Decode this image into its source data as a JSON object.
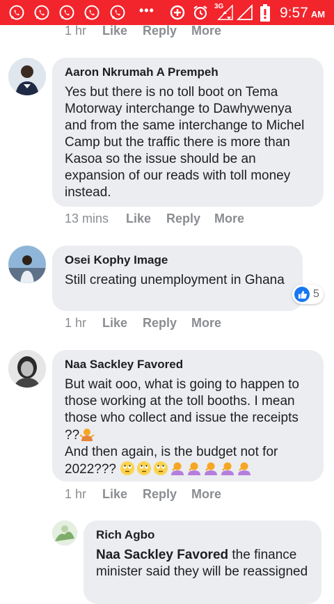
{
  "statusbar": {
    "network": "3G",
    "time": "9:57",
    "ampm": "AM",
    "color": "#f2242c"
  },
  "labels": {
    "like": "Like",
    "reply": "Reply",
    "more": "More"
  },
  "top_actions": {
    "time": "1 hr"
  },
  "comments": [
    {
      "author": "Aaron Nkrumah A Prempeh",
      "text": "Yes but there is no toll boot on Tema Motorway interchange to Dawhywenya and from the same interchange to Michel Camp but the traffic there is more than Kasoa so the issue should be an expansion of our reads with toll money instead.",
      "time": "13 mins"
    },
    {
      "author": "Osei Kophy Image",
      "text": "Still creating unemployment in Ghana",
      "time": "1 hr",
      "reaction_count": "5"
    },
    {
      "author": "Naa Sackley Favored",
      "text_line1": "But wait ooo, what is going to happen to those working at the toll booths. I mean those who collect and issue the receipts ??",
      "text_line2": "And then again, is the budget not for 2022???",
      "time": "1 hr"
    }
  ],
  "reply": {
    "author": "Rich Agbo",
    "mention": "Naa Sackley Favored",
    "text": " the finance minister said they will be reassigned"
  }
}
